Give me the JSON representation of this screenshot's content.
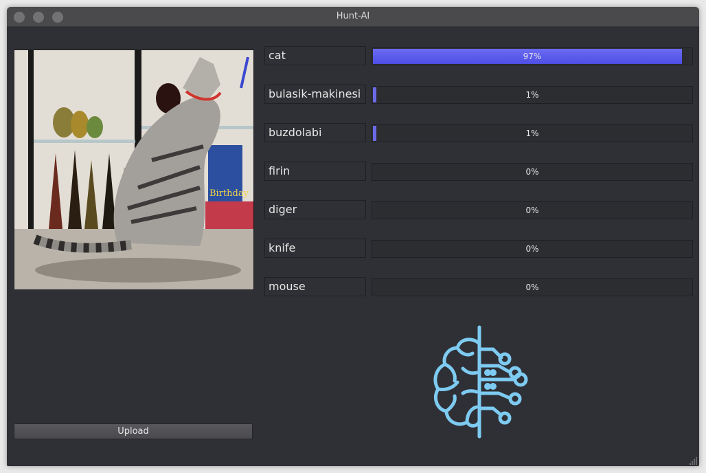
{
  "window": {
    "title": "Hunt-AI"
  },
  "predictions": [
    {
      "label": "cat",
      "percent": 97
    },
    {
      "label": "bulasik-makinesi",
      "percent": 1
    },
    {
      "label": "buzdolabi",
      "percent": 1
    },
    {
      "label": "firin",
      "percent": 0
    },
    {
      "label": "diger",
      "percent": 0
    },
    {
      "label": "knife",
      "percent": 0
    },
    {
      "label": "mouse",
      "percent": 0
    }
  ],
  "percent_text": [
    "97%",
    "1%",
    "1%",
    "0%",
    "0%",
    "0%",
    "0%"
  ],
  "upload_button": {
    "label": "Upload"
  },
  "image_panel": {
    "description": "",
    "text": "Birthday"
  },
  "colors": {
    "progress_fill": "#5b5bee",
    "logo": "#7ecbf2",
    "background": "#2f3035"
  },
  "icons": {
    "logo": "brain-circuit-icon",
    "close": "close-icon",
    "minimize": "minimize-icon",
    "maximize": "maximize-icon",
    "resize": "resize-grip-icon"
  }
}
